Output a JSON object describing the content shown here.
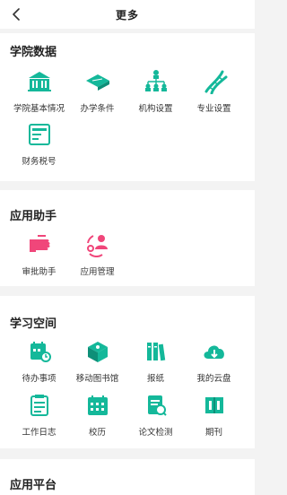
{
  "header": {
    "title": "更多"
  },
  "sections": [
    {
      "title": "学院数据",
      "items": [
        {
          "label": "学院基本情况",
          "icon": "building-icon"
        },
        {
          "label": "办学条件",
          "icon": "diploma-icon"
        },
        {
          "label": "机构设置",
          "icon": "org-chart-icon"
        },
        {
          "label": "专业设置",
          "icon": "dna-icon"
        },
        {
          "label": "财务税号",
          "icon": "tax-card-icon"
        }
      ]
    },
    {
      "title": "应用助手",
      "items": [
        {
          "label": "审批助手",
          "icon": "approval-hand-icon"
        },
        {
          "label": "应用管理",
          "icon": "app-manage-icon"
        }
      ]
    },
    {
      "title": "学习空间",
      "items": [
        {
          "label": "待办事项",
          "icon": "todo-calendar-icon"
        },
        {
          "label": "移动图书馆",
          "icon": "library-cube-icon"
        },
        {
          "label": "报纸",
          "icon": "newspaper-icon"
        },
        {
          "label": "我的云盘",
          "icon": "cloud-drive-icon"
        },
        {
          "label": "工作日志",
          "icon": "worklog-icon"
        },
        {
          "label": "校历",
          "icon": "school-calendar-icon"
        },
        {
          "label": "论文检测",
          "icon": "paper-check-icon"
        },
        {
          "label": "期刊",
          "icon": "journal-icon"
        }
      ]
    },
    {
      "title": "应用平台",
      "items": []
    }
  ],
  "colors": {
    "teal": "#14b89a",
    "pink": "#f0467a",
    "background": "#f3f3f3"
  }
}
